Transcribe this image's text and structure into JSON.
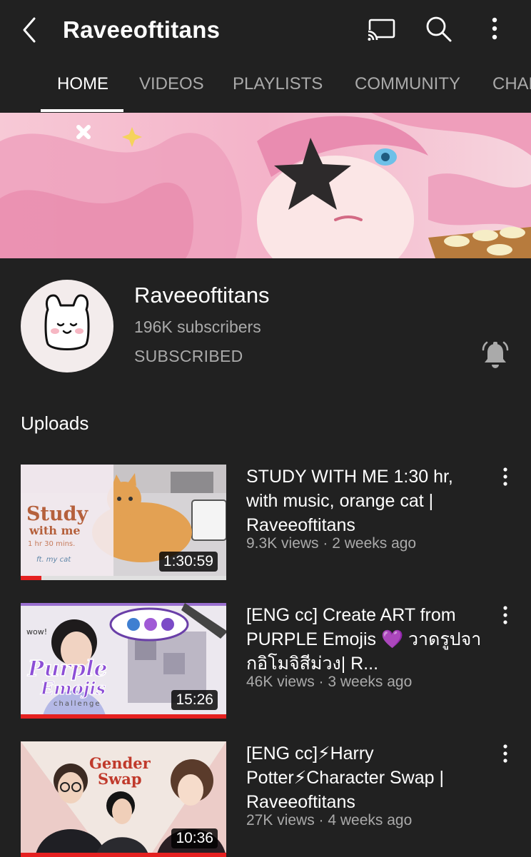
{
  "header": {
    "title": "Raveeoftitans",
    "back_icon": "chevron-left-icon",
    "cast_icon": "cast-icon",
    "search_icon": "search-icon",
    "more_icon": "more-vertical-icon"
  },
  "tabs": [
    {
      "label": "HOME",
      "active": true
    },
    {
      "label": "VIDEOS",
      "active": false
    },
    {
      "label": "PLAYLISTS",
      "active": false
    },
    {
      "label": "COMMUNITY",
      "active": false
    },
    {
      "label": "CHANNELS",
      "active": false
    }
  ],
  "channel": {
    "name": "Raveeoftitans",
    "subscribers": "196K subscribers",
    "subscribe_state": "SUBSCRIBED",
    "bell_icon": "notification-bell-icon"
  },
  "section_title": "Uploads",
  "videos": [
    {
      "title": "STUDY WITH ME 1:30 hr, with music, orange cat | Raveeoftitans",
      "meta": "9.3K views · 2 weeks ago",
      "duration": "1:30:59",
      "watched_fraction": 0.1,
      "thumb_text": {
        "line1": "Study",
        "line2": "with me",
        "line3": "1 hr 30 mins.",
        "line4": "ft. my cat"
      }
    },
    {
      "title": "[ENG cc] Create ART from PURPLE Emojis 💜 วาดรูปจากอิโมจิสีม่วง| R...",
      "meta": "46K views · 3 weeks ago",
      "duration": "15:26",
      "watched_fraction": 1.0,
      "thumb_text": {
        "line1": "wow!",
        "line2": "Purple",
        "line3": "Emojis",
        "line4": "challenge"
      }
    },
    {
      "title": "[ENG cc]⚡Harry Potter⚡Character Swap | Raveeoftitans",
      "meta": "27K views · 4 weeks ago",
      "duration": "10:36",
      "watched_fraction": 1.0,
      "thumb_text": {
        "line1": "Gender",
        "line2": "Swap"
      }
    }
  ],
  "colors": {
    "background": "#212121",
    "text_primary": "#ffffff",
    "text_secondary": "#aaaaaa",
    "progress": "#e52020"
  }
}
